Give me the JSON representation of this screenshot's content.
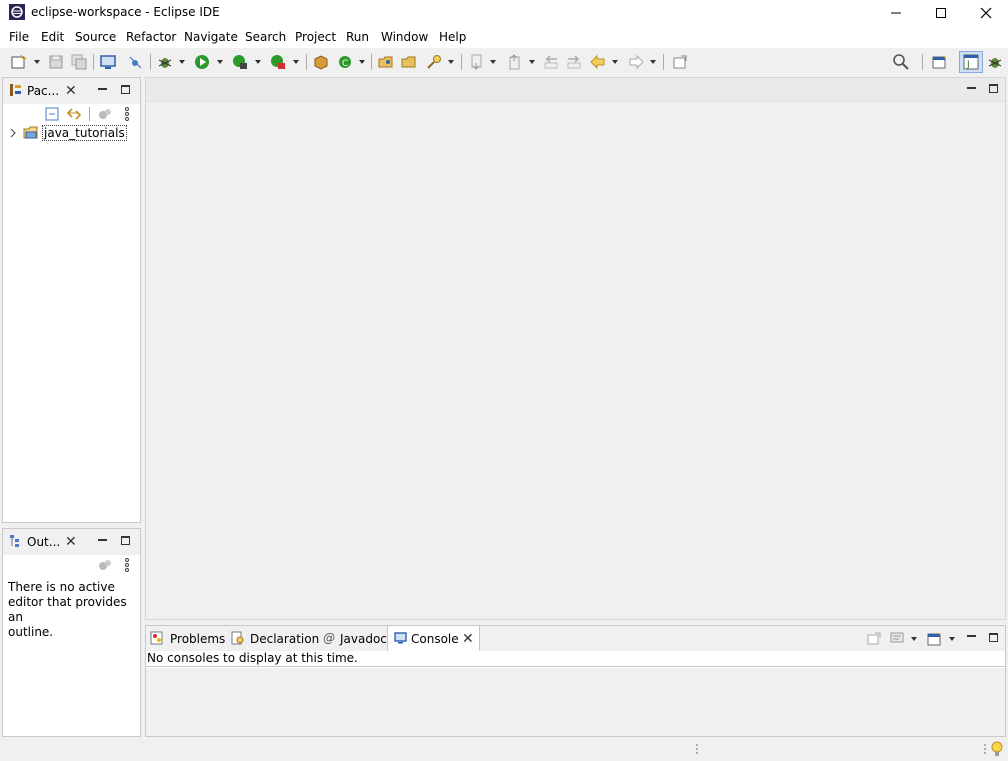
{
  "window": {
    "title": "eclipse-workspace - Eclipse IDE",
    "icon": "eclipse-icon"
  },
  "menubar": {
    "items": [
      {
        "label": "File"
      },
      {
        "label": "Edit"
      },
      {
        "label": "Source"
      },
      {
        "label": "Refactor"
      },
      {
        "label": "Navigate"
      },
      {
        "label": "Search"
      },
      {
        "label": "Project"
      },
      {
        "label": "Run"
      },
      {
        "label": "Window"
      },
      {
        "label": "Help"
      }
    ]
  },
  "package_explorer": {
    "tab_label": "Pac...",
    "tree": [
      {
        "label": "java_tutorials",
        "icon": "project-folder-icon",
        "expanded": false
      }
    ]
  },
  "outline": {
    "tab_label": "Out...",
    "empty_message_line1": "There is no active",
    "empty_message_line2": "editor that provides an",
    "empty_message_line3": "outline."
  },
  "bottom_panel": {
    "tabs": [
      {
        "label": "Problems",
        "icon": "problems-icon"
      },
      {
        "label": "Declaration",
        "icon": "declaration-icon"
      },
      {
        "label": "Javadoc",
        "icon": "javadoc-icon",
        "glyph": "@"
      },
      {
        "label": "Console",
        "icon": "console-icon",
        "active": true
      }
    ],
    "console_message": "No consoles to display at this time."
  },
  "colors": {
    "background": "#f0f0f0",
    "panel_border": "#c8c8c8",
    "accent_blue": "#2e5fa8",
    "run_green": "#2a9a2a"
  }
}
